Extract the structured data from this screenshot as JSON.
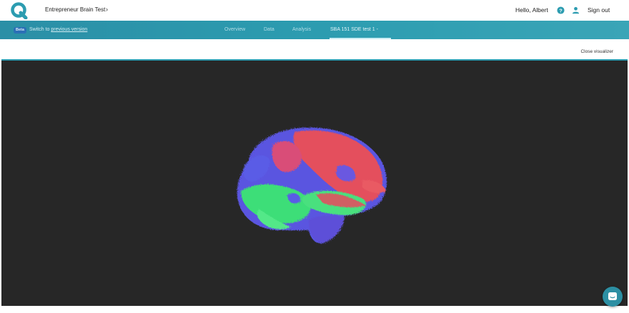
{
  "header": {
    "project_name": "Entrepreneur Brain Test",
    "greeting": "Hello, Albert",
    "sign_out_label": "Sign out"
  },
  "nav": {
    "beta_badge": "Beta",
    "switch_text": "Switch to",
    "switch_link": "previous version",
    "tabs": [
      {
        "label": "Overview"
      },
      {
        "label": "Data"
      },
      {
        "label": "Analysis"
      },
      {
        "label": "SBA 151 SDE test 1 -"
      }
    ]
  },
  "viewer": {
    "close_label": "Close visualizer"
  },
  "colors": {
    "brand": "#2c9cb0",
    "viewer_bg": "#272727",
    "fiber_red": "#e8505e",
    "fiber_green": "#3fe07a",
    "fiber_blue": "#5a5ae8"
  },
  "icons": {
    "logo": "q-logo-icon",
    "help": "help-icon",
    "user": "user-icon",
    "chat": "chat-icon"
  }
}
